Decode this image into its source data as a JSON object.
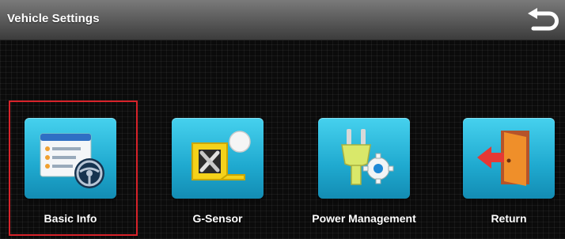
{
  "header": {
    "title": "Vehicle Settings",
    "back_icon": "return-arrow-icon"
  },
  "menu": {
    "items": [
      {
        "label": "Basic Info",
        "icon": "vehicle-info-icon",
        "selected": true
      },
      {
        "label": "G-Sensor",
        "icon": "g-sensor-icon",
        "selected": false
      },
      {
        "label": "Power Management",
        "icon": "power-plug-gear-icon",
        "selected": false
      },
      {
        "label": "Return",
        "icon": "exit-door-icon",
        "selected": false
      }
    ]
  },
  "colors": {
    "tile": "#1fa9cf",
    "selection_border": "#d8232a",
    "header": "#5e5e5e"
  }
}
